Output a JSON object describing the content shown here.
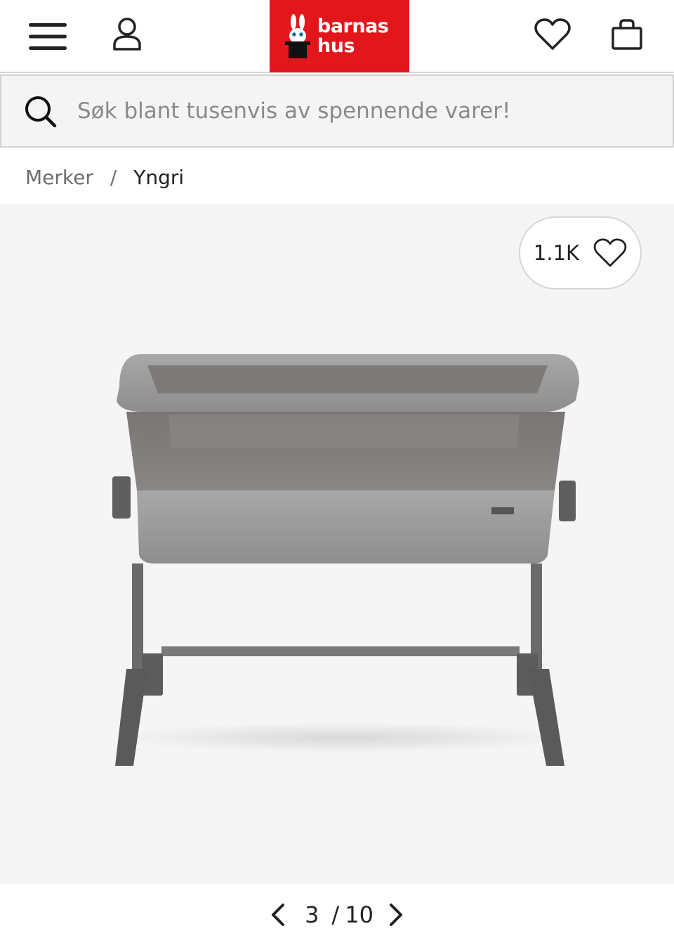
{
  "header": {
    "menu_icon": "hamburger-menu-icon",
    "account_icon": "user-icon",
    "wishlist_icon": "heart-icon",
    "cart_icon": "shopping-bag-icon",
    "logo": {
      "line1": "barnas",
      "line2": "hus",
      "brand_color": "#e3161b"
    }
  },
  "search": {
    "placeholder": "Søk blant tusenvis av spennende varer!",
    "icon": "search-icon"
  },
  "breadcrumb": {
    "items": [
      "Merker",
      "Yngri"
    ],
    "separator": "/"
  },
  "gallery": {
    "favorite_count": "1.1K",
    "favorite_icon": "heart-icon",
    "product_brand_tag": "Yngri",
    "pagination": {
      "current": "3",
      "separator": "/",
      "total": "10"
    }
  }
}
